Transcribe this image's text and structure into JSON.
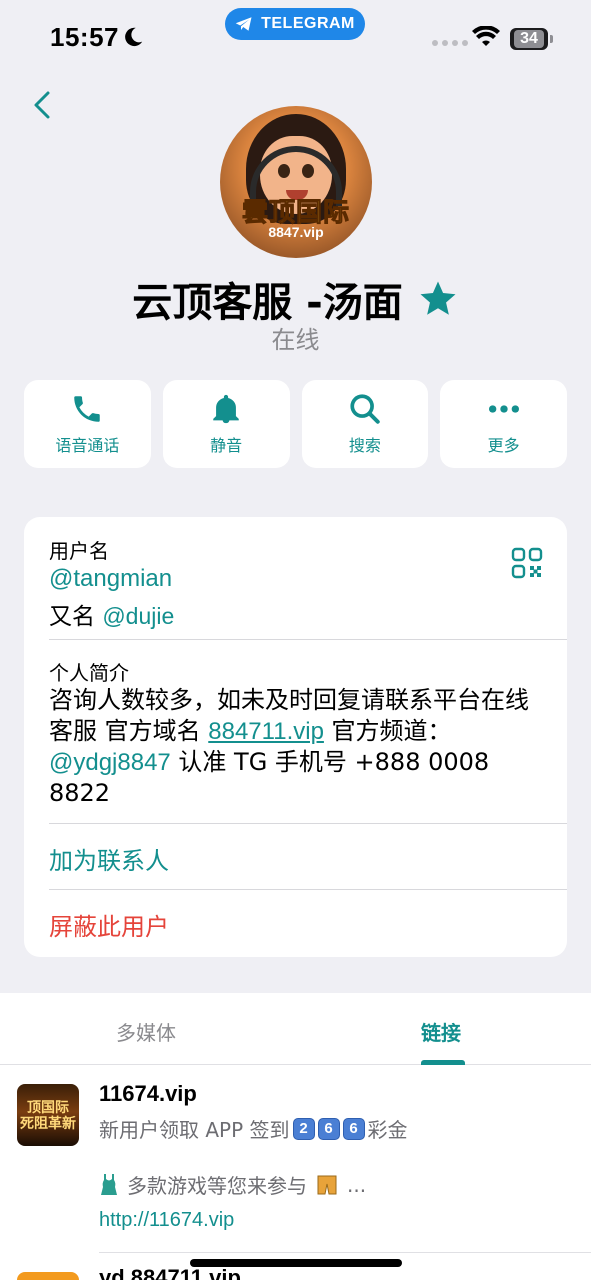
{
  "status_bar": {
    "time": "15:57",
    "app_pill": "TELEGRAM",
    "battery": "34"
  },
  "profile": {
    "avatar_brand": "雲顶国际",
    "avatar_url": "8847.vip",
    "name": "云顶客服 -汤面",
    "presence": "在线"
  },
  "actions": [
    {
      "label": "语音通话",
      "icon": "phone-icon"
    },
    {
      "label": "静音",
      "icon": "bell-icon"
    },
    {
      "label": "搜索",
      "icon": "search-icon"
    },
    {
      "label": "更多",
      "icon": "more-icon"
    }
  ],
  "info": {
    "username_label": "用户名",
    "username": "@tangmian",
    "alias_prefix": "又名",
    "alias": "@dujie",
    "bio_label": "个人简介",
    "bio_part1": "咨询人数较多，如未及时回复请联系平台在线客服 官方域名 ",
    "bio_link": "884711.vip",
    "bio_part2": " 官方频道：",
    "bio_channel": "@ydgj8847",
    "bio_part3": " 认准 TG 手机号 +888 0008 8822",
    "add_contact": "加为联系人",
    "block_user": "屏蔽此用户"
  },
  "tabs": {
    "media": "多媒体",
    "links": "链接"
  },
  "links": [
    {
      "thumb_text": "顶国际\n死阻革新",
      "title": "11674.vip",
      "desc_prefix": "新用户领取 APP 签到",
      "desc_keys": [
        "2",
        "6",
        "6"
      ],
      "desc_suffix": "彩金",
      "desc2": "多款游戏等您来参与",
      "desc2_tail": "...",
      "url": "http://11674.vip"
    },
    {
      "title": "yd 884711.vip"
    }
  ],
  "colors": {
    "accent": "#138f8e",
    "danger": "#e5443a",
    "background": "#efeff4",
    "telegram_blue": "#1f87e8"
  }
}
